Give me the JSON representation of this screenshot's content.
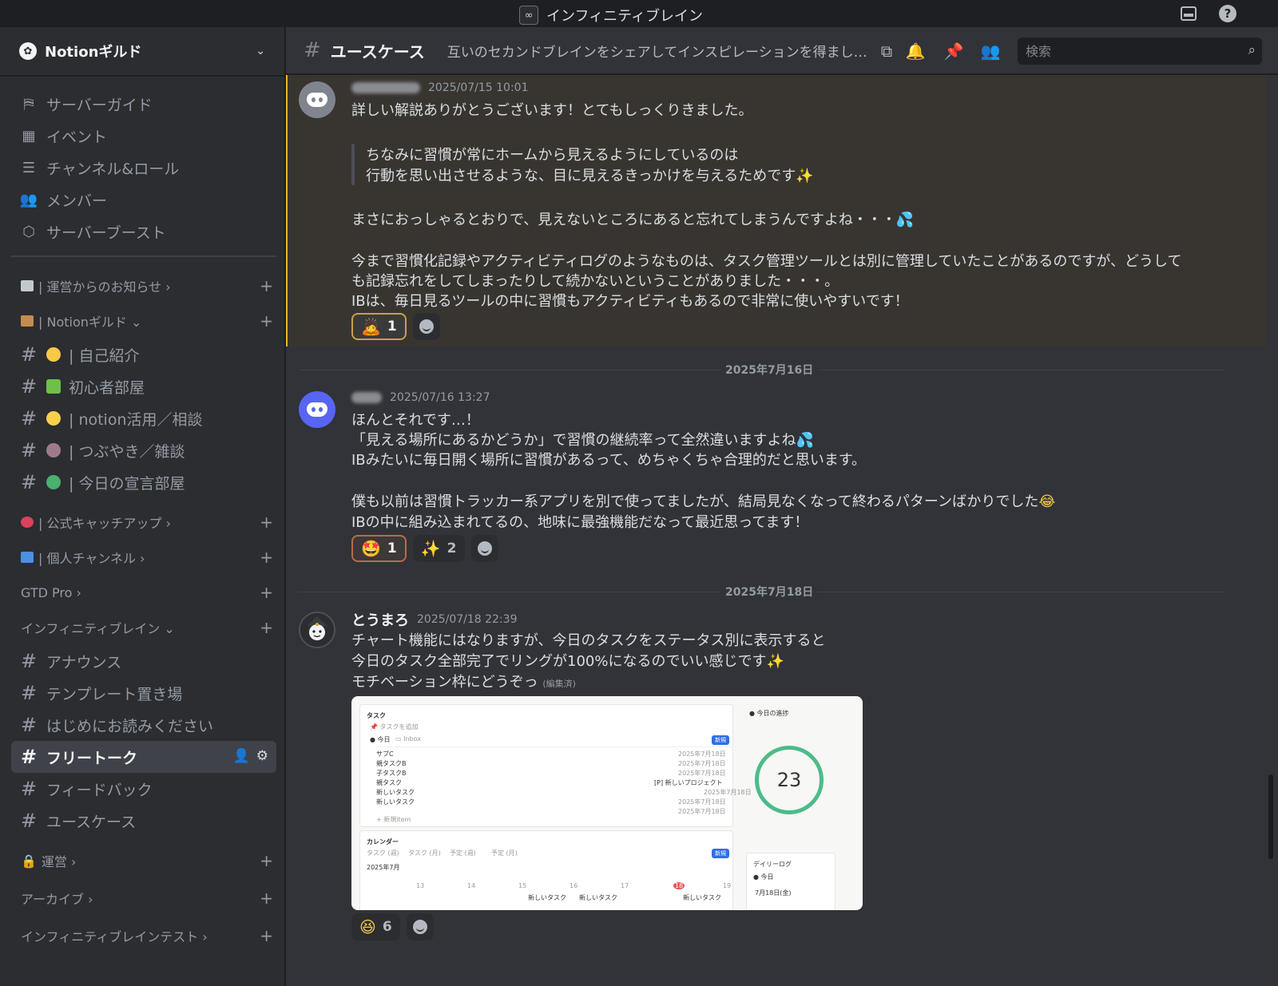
{
  "window": {
    "title": "インフィニティブレイン"
  },
  "colors": {
    "accent_highlight": "#f0b232",
    "blurple": "#5865f2",
    "ring_green": "#4dbb8a"
  },
  "guild": {
    "name": "Notionギルド"
  },
  "sidebar": {
    "top_items": [
      {
        "icon": "signpost-icon",
        "label": "サーバーガイド"
      },
      {
        "icon": "calendar-icon",
        "label": "イベント"
      },
      {
        "icon": "channel-list-icon",
        "label": "チャンネル&ロール"
      },
      {
        "icon": "members-icon",
        "label": "メンバー"
      },
      {
        "icon": "boost-icon",
        "label": "サーバーブースト"
      }
    ],
    "categories": {
      "announce": "| 運営からのお知らせ ›",
      "notion_guild": "| Notionギルド ⌄",
      "catchup": "| 公式キャッチアップ ›",
      "personal": "| 個人チャンネル ›",
      "gtd": "GTD Pro ›",
      "infinity": "インフィニティブレイン ⌄",
      "ops": "運営 ›",
      "archive": "アーカイブ ›",
      "infinity_test": "インフィニティブレインテスト ›"
    },
    "guild_channels": [
      {
        "label": "| 自己紹介"
      },
      {
        "label": "初心者部屋"
      },
      {
        "label": "| notion活用／相談"
      },
      {
        "label": "| つぶやき／雑談"
      },
      {
        "label": "| 今日の宣言部屋"
      }
    ],
    "infinity_channels": [
      {
        "label": "アナウンス"
      },
      {
        "label": "テンプレート置き場"
      },
      {
        "label": "はじめにお読みください"
      },
      {
        "label": "フリートーク"
      },
      {
        "label": "フィードバック"
      },
      {
        "label": "ユースケース"
      }
    ]
  },
  "channel_header": {
    "name": "ユースケース",
    "topic": "互いのセカンドブレインをシェアしてインスピレーションを得ましょ…",
    "search_placeholder": "検索"
  },
  "messages": [
    {
      "timestamp": "2025/07/15 10:01",
      "lines": {
        "l1": "詳しい解説ありがとうございます！とてもしっくりきました。",
        "q1": "ちなみに習慣が常にホームから見えるようにしているのは",
        "q2": "行動を思い出させるような、目に見えるきっかけを与えるためです",
        "l2": "まさにおっしゃるとおりで、見えないところにあると忘れてしまうんですよね・・・",
        "l3": "今まで習慣化記録やアクティビティログのようなものは、タスク管理ツールとは別に管理していたことがあるのですが、どうして",
        "l4": "も記録忘れをしてしまったりして続かないということがありました・・・。",
        "l5": "IBは、毎日見るツールの中に習慣もアクティビティもあるので非常に使いやすいです！"
      },
      "reactions": [
        {
          "emoji": "🙇",
          "count": "1"
        }
      ]
    },
    {
      "date_divider": "2025年7月16日",
      "timestamp": "2025/07/16 13:27",
      "lines": {
        "l1": "ほんとそれです…！",
        "l2": "「見える場所にあるかどうか」で習慣の継続率って全然違いますよね",
        "l3": "IBみたいに毎日開く場所に習慣があるって、めちゃくちゃ合理的だと思います。",
        "l4": "僕も以前は習慣トラッカー系アプリを別で使ってましたが、結局見なくなって終わるパターンばかりでした",
        "l5": "IBの中に組み込まれてるの、地味に最強機能だなって最近思ってます！"
      },
      "reactions": [
        {
          "emoji": "🤩",
          "count": "1"
        },
        {
          "emoji": "✨",
          "count": "2"
        }
      ]
    },
    {
      "date_divider": "2025年7月18日",
      "username": "とうまろ",
      "timestamp": "2025/07/18 22:39",
      "lines": {
        "l1": "チャート機能にはなりますが、今日のタスクをステータス別に表示すると",
        "l2": "今日のタスク全部完了でリングが100%になるのでいい感じです",
        "l3": "モチベーション枠にどうぞっ",
        "edited": "(編集済)"
      },
      "embed": {
        "tasks_title": "タスク",
        "add_task": "タスクを追加",
        "tabs": [
          "今日",
          "Inbox"
        ],
        "new_btn": "新規",
        "rows": [
          {
            "name": "サブC",
            "date": "2025年7月18日"
          },
          {
            "name": "親タスクB",
            "date": "2025年7月18日"
          },
          {
            "name": "子タスクB",
            "date": "2025年7月18日"
          },
          {
            "name": "親タスク",
            "project": "[P] 新しいプロジェクト",
            "date": "2025年7月18日"
          },
          {
            "name": "新しいタスク",
            "date": "2025年7月18日"
          },
          {
            "name": "新しいタスク",
            "date": "2025年7月18日"
          }
        ],
        "new_item": "+ 新規item",
        "today_progress": "今日の進捗",
        "ring_value": "23",
        "calendar_title": "カレンダー",
        "cal_tabs": [
          "タスク (週)",
          "タスク (月)",
          "予定 (週)",
          "予定 (月)"
        ],
        "month": "2025年7月",
        "cal_days": [
          "13",
          "14",
          "15",
          "16",
          "17",
          "18",
          "19"
        ],
        "cal_event": "新しいタスク",
        "daily_log": "デイリーログ",
        "daily_date": "7月18日(金)"
      },
      "reactions": [
        {
          "emoji": "😆",
          "count": "6"
        }
      ]
    }
  ]
}
